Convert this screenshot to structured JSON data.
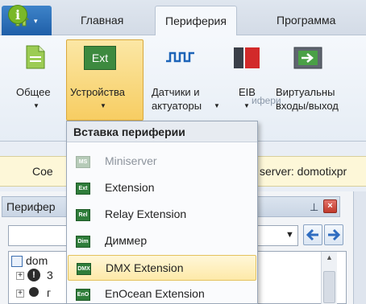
{
  "ribbon_tabs": {
    "home_caret": "▾",
    "tab_home": "Главная",
    "tab_periphery": "Периферия",
    "tab_program": "Программа"
  },
  "ribbon": {
    "general": "Общее",
    "devices": "Устройства",
    "sensors_line1": "Датчики и",
    "sensors_line2": "актуаторы",
    "eib": "EIB",
    "virtual_line1": "Виртуальны",
    "virtual_line2": "входы/выход",
    "group_label": "ифери",
    "devices_icon_text": "Ext"
  },
  "infobar": {
    "text_left": "Сое",
    "text_right": "server: domotixpr"
  },
  "panel": {
    "title": "Перифер",
    "pin": "ᵖ",
    "close": "×",
    "tree_root": "dom",
    "tree_item_1": "3",
    "tree_item_2": "г"
  },
  "menu": {
    "header": "Вставка периферии",
    "items": [
      {
        "label": "Miniserver",
        "icon": "MS",
        "disabled": true
      },
      {
        "label": "Extension",
        "icon": "Ext"
      },
      {
        "label": "Relay Extension",
        "icon": "Rel"
      },
      {
        "label": "Диммер",
        "icon": "Dim"
      },
      {
        "label": "DMX Extension",
        "icon": "DMX",
        "highlighted": true
      },
      {
        "label": "EnOcean Extension",
        "icon": "EnO"
      }
    ]
  },
  "colors": {
    "accent_blue": "#1f5fa8",
    "highlight": "#fde9a8",
    "icon_green": "#2f7d3a"
  }
}
